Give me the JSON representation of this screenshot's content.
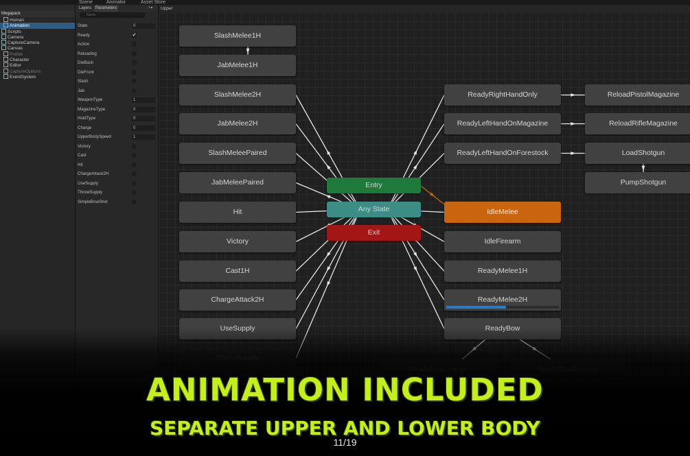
{
  "editor_tabs": [
    "Scene",
    "Animator",
    "Asset Store"
  ],
  "hierarchy": {
    "title": "Megapack",
    "items": [
      {
        "label": "Human",
        "indent": 1,
        "state": "normal"
      },
      {
        "label": "Animation",
        "indent": 1,
        "state": "selected"
      },
      {
        "label": "Scripts",
        "indent": 0,
        "state": "normal"
      },
      {
        "label": "Camera",
        "indent": 0,
        "state": "normal"
      },
      {
        "label": "CaptureCamera",
        "indent": 0,
        "state": "normal"
      },
      {
        "label": "Canvas",
        "indent": 0,
        "state": "normal"
      },
      {
        "label": "Prefab",
        "indent": 1,
        "state": "dim"
      },
      {
        "label": "Character",
        "indent": 1,
        "state": "normal"
      },
      {
        "label": "Editor",
        "indent": 1,
        "state": "normal"
      },
      {
        "label": "CaptureOptions",
        "indent": 1,
        "state": "dim"
      },
      {
        "label": "EventSystem",
        "indent": 1,
        "state": "normal"
      }
    ]
  },
  "animator": {
    "tabs": [
      "Layers",
      "Parameters"
    ],
    "active_tab": "Parameters",
    "search_placeholder": "Name",
    "breadcrumb": "Upper",
    "parameters": [
      {
        "name": "State",
        "kind": "int",
        "value": "0"
      },
      {
        "name": "Ready",
        "kind": "bool",
        "value": "✔"
      },
      {
        "name": "Action",
        "kind": "bool",
        "value": ""
      },
      {
        "name": "Reloading",
        "kind": "bool",
        "value": ""
      },
      {
        "name": "DieBack",
        "kind": "bool",
        "value": ""
      },
      {
        "name": "DieFront",
        "kind": "bool",
        "value": ""
      },
      {
        "name": "Slash",
        "kind": "trigger",
        "value": ""
      },
      {
        "name": "Jab",
        "kind": "trigger",
        "value": ""
      },
      {
        "name": "WeaponType",
        "kind": "int",
        "value": "1"
      },
      {
        "name": "MagazineType",
        "kind": "int",
        "value": "0"
      },
      {
        "name": "HoldType",
        "kind": "int",
        "value": "0"
      },
      {
        "name": "Charge",
        "kind": "int",
        "value": "0"
      },
      {
        "name": "UpperBodySpeed",
        "kind": "float",
        "value": "1"
      },
      {
        "name": "Victory",
        "kind": "trigger",
        "value": ""
      },
      {
        "name": "Cast",
        "kind": "trigger",
        "value": ""
      },
      {
        "name": "Hit",
        "kind": "trigger",
        "value": ""
      },
      {
        "name": "ChargeAttack2H",
        "kind": "trigger",
        "value": ""
      },
      {
        "name": "UseSupply",
        "kind": "trigger",
        "value": ""
      },
      {
        "name": "ThrowSupply",
        "kind": "trigger",
        "value": ""
      },
      {
        "name": "SimpleBowShot",
        "kind": "trigger",
        "value": ""
      }
    ],
    "states_left": [
      "SlashMelee1H",
      "JabMelee1H",
      "SlashMelee2H",
      "JabMelee2H",
      "SlashMeleePaired",
      "JabMeleePaired",
      "Hit",
      "Victory",
      "Cast1H",
      "ChargeAttack2H",
      "UseSupply",
      "ThrowSupply"
    ],
    "states_center": {
      "entry": "Entry",
      "any_state": "Any State",
      "exit": "Exit"
    },
    "states_right": [
      "ReadyRightHandOnly",
      "ReadyLeftHandOnMagazine",
      "ReadyLeftHandOnForestock",
      "IdleMelee",
      "IdleFirearm",
      "ReadyMelee1H",
      "ReadyMelee2H",
      "ReadyBow"
    ],
    "states_far_right": [
      "ReloadPistolMagazine",
      "ReloadRifleMagazine",
      "LoadShotgun",
      "PumpShotgun"
    ],
    "states_bottom": [
      "ReadyBowCharge",
      "ReadyBowRelease"
    ],
    "default_state": "IdleMelee",
    "active_state": "ReadyMelee2H",
    "active_state_progress": 0.53
  },
  "banner": {
    "title": "ANIMATION INCLUDED",
    "subtitle": "SEPARATE UPPER AND LOWER BODY"
  },
  "slide_counter": "11/19",
  "colors": {
    "entry": "#1d7a3a",
    "any_state": "#3b8d86",
    "exit": "#a21616",
    "default_state": "#c9650e",
    "progress": "#2b78c4",
    "banner_text": "#c4ef1a"
  }
}
